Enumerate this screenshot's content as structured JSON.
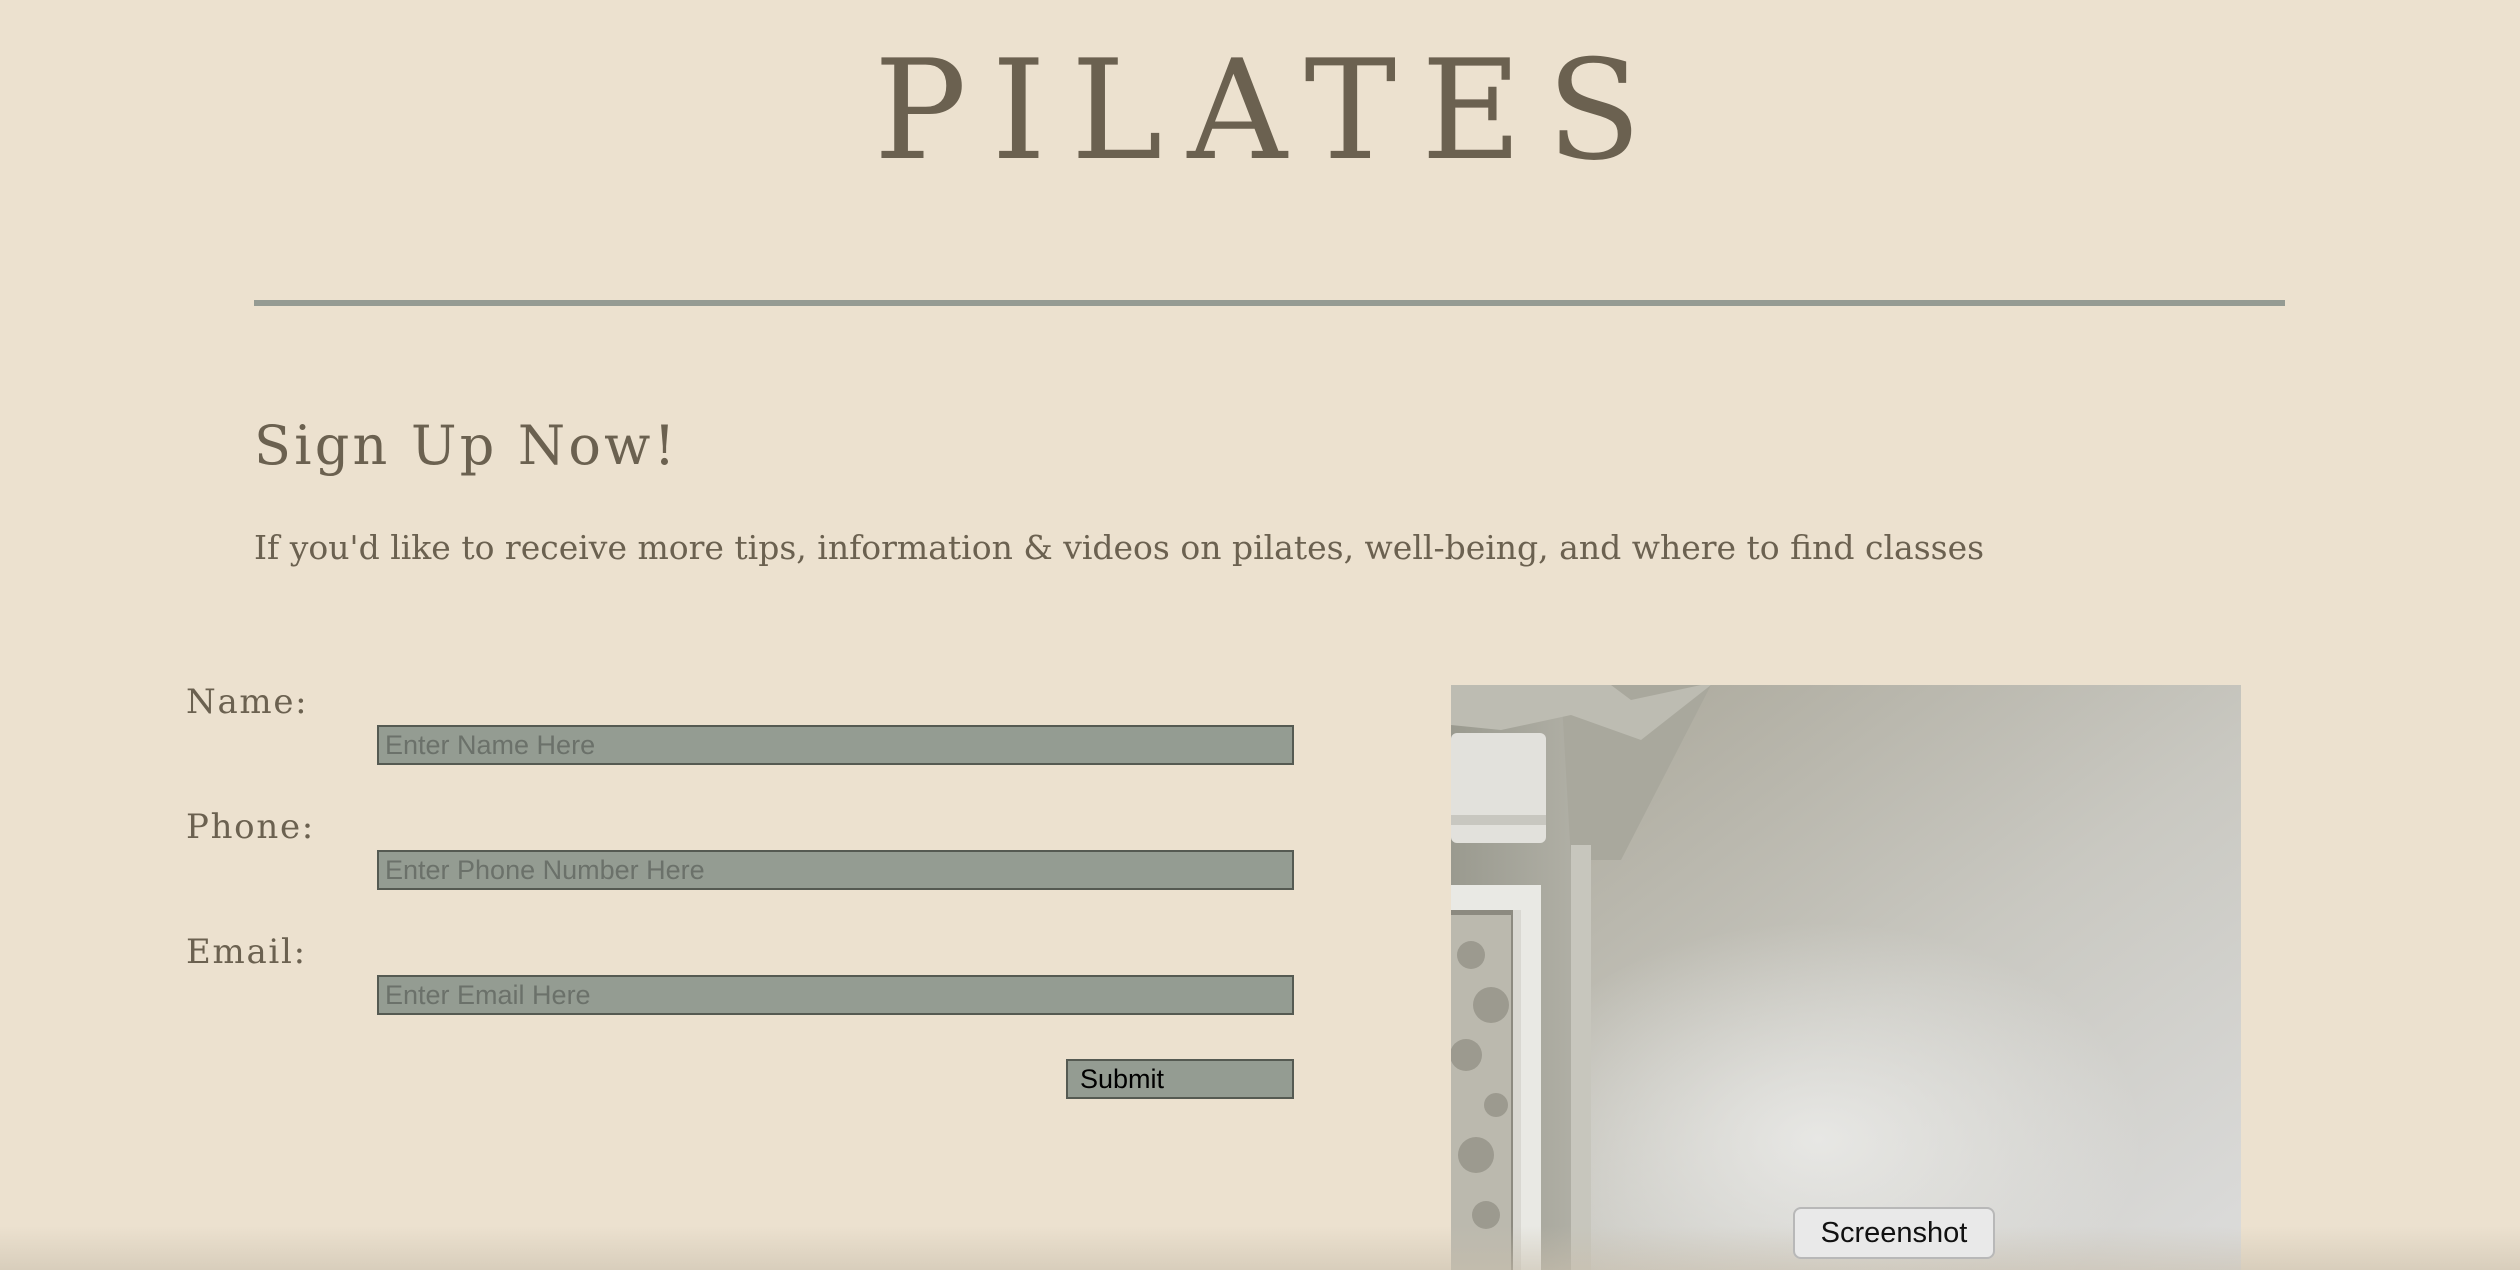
{
  "header": {
    "title": "PILATES"
  },
  "signup": {
    "heading": "Sign Up Now!",
    "intro": "If you'd like to receive more tips, information & videos on pilates, well-being, and where to find classes"
  },
  "form": {
    "name_label": "Name:",
    "name_placeholder": "Enter Name Here",
    "phone_label": "Phone:",
    "phone_placeholder": "Enter Phone Number Here",
    "email_label": "Email:",
    "email_placeholder": "Enter Email Here",
    "submit_label": "Submit"
  },
  "tooltip": {
    "text": "Screenshot"
  },
  "colors": {
    "background": "#ece1cf",
    "text": "#6b6150",
    "divider": "#959b93",
    "input_fill": "#949c92"
  }
}
